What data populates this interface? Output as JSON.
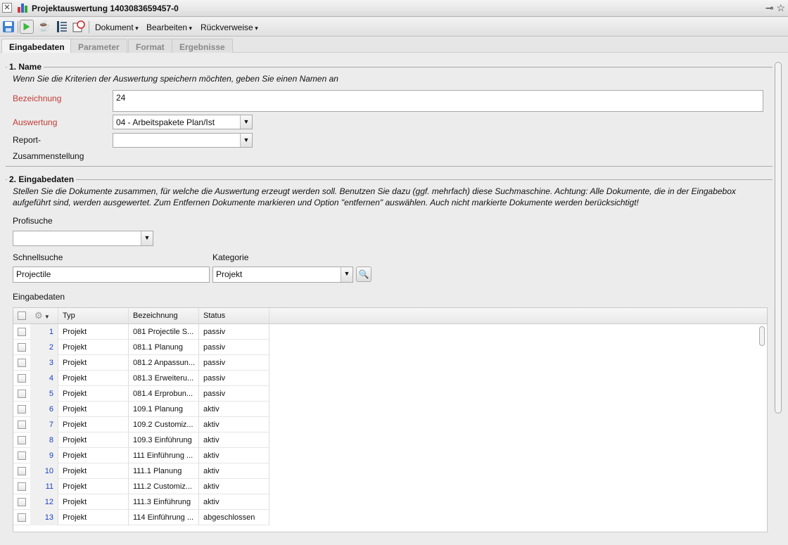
{
  "window": {
    "title": "Projektauswertung 1403083659457-0"
  },
  "toolbar": {
    "menus": [
      "Dokument",
      "Bearbeiten",
      "Rückverweise"
    ]
  },
  "tabs": [
    "Eingabedaten",
    "Parameter",
    "Format",
    "Ergebnisse"
  ],
  "section1": {
    "legend": "1. Name",
    "hint": "Wenn Sie die Kriterien der Auswertung speichern möchten, geben Sie einen Namen an",
    "bezeichnung_label": "Bezeichnung",
    "bezeichnung_value": "24",
    "auswertung_label": "Auswertung",
    "auswertung_value": "04 - Arbeitspakete Plan/Ist",
    "report_label": "Report-",
    "report_label2": "Zusammenstellung",
    "report_value": ""
  },
  "section2": {
    "legend": "2. Eingabedaten",
    "hint": "Stellen Sie die Dokumente zusammen, für welche die Auswertung erzeugt werden soll. Benutzen Sie dazu (ggf. mehrfach) diese Suchmaschine. Achtung: Alle Dokumente, die in der Eingabebox aufgeführt sind, werden ausgewertet. Zum Entfernen Dokumente markieren und Option \"entfernen\" auswählen. Auch nicht markierte Dokumente werden berücksichtigt!",
    "profisuche_label": "Profisuche",
    "profisuche_value": "",
    "schnellsuche_label": "Schnellsuche",
    "schnellsuche_value": "Projectile",
    "kategorie_label": "Kategorie",
    "kategorie_value": "Projekt",
    "grid_label": "Eingabedaten"
  },
  "grid": {
    "columns": [
      "Typ",
      "Bezeichnung",
      "Status"
    ],
    "rows": [
      [
        "1",
        "Projekt",
        "081 Projectile S...",
        "passiv"
      ],
      [
        "2",
        "Projekt",
        "081.1 Planung",
        "passiv"
      ],
      [
        "3",
        "Projekt",
        "081.2 Anpassun...",
        "passiv"
      ],
      [
        "4",
        "Projekt",
        "081.3 Erweiteru...",
        "passiv"
      ],
      [
        "5",
        "Projekt",
        "081.4 Erprobun...",
        "passiv"
      ],
      [
        "6",
        "Projekt",
        "109.1 Planung",
        "aktiv"
      ],
      [
        "7",
        "Projekt",
        "109.2 Customiz...",
        "aktiv"
      ],
      [
        "8",
        "Projekt",
        "109.3 Einführung",
        "aktiv"
      ],
      [
        "9",
        "Projekt",
        "111 Einführung ...",
        "aktiv"
      ],
      [
        "10",
        "Projekt",
        "111.1 Planung",
        "aktiv"
      ],
      [
        "11",
        "Projekt",
        "111.2 Customiz...",
        "aktiv"
      ],
      [
        "12",
        "Projekt",
        "111.3 Einführung",
        "aktiv"
      ],
      [
        "13",
        "Projekt",
        "114 Einführung ...",
        "abgeschlossen"
      ]
    ]
  }
}
